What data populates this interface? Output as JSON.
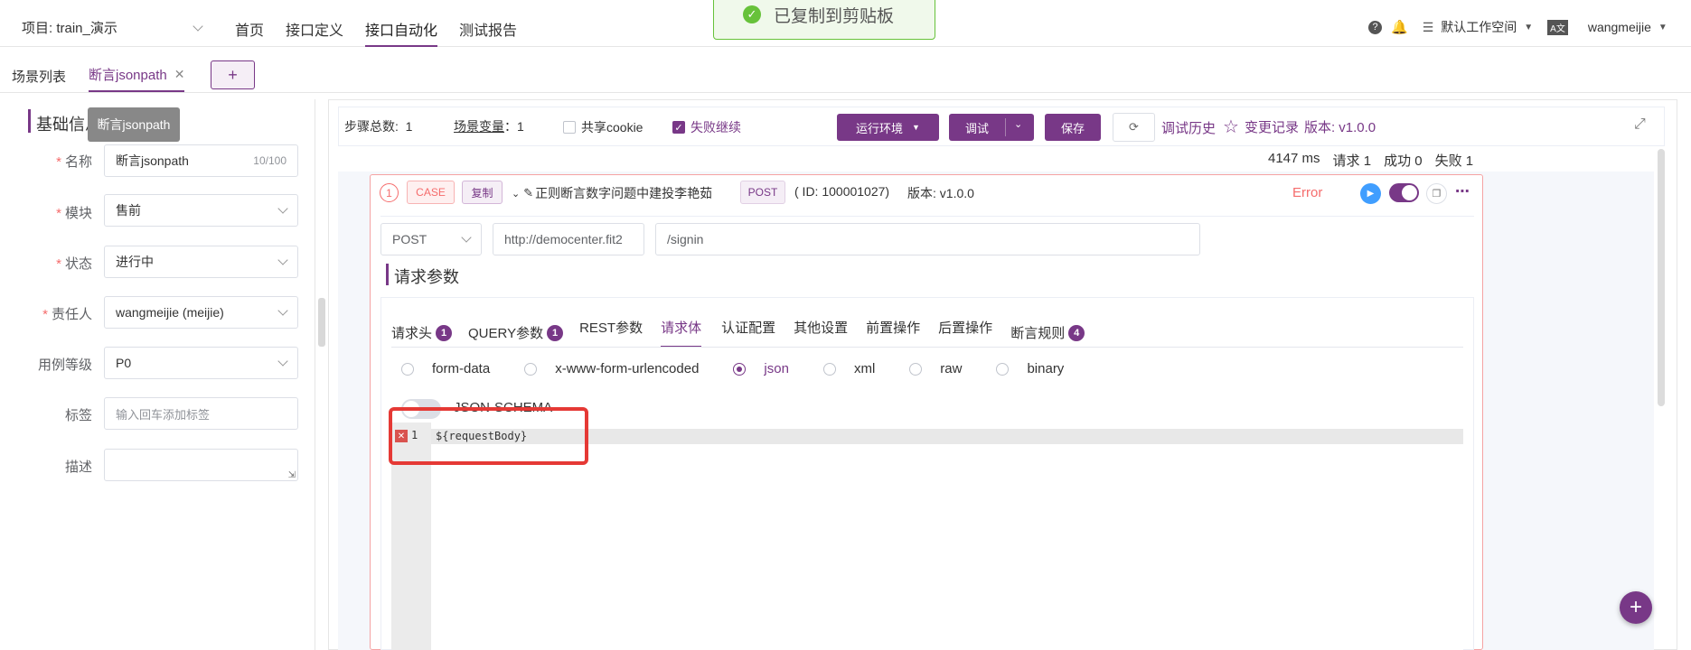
{
  "topbar": {
    "project_label": "项目: train_演示",
    "nav": [
      "首页",
      "接口定义",
      "接口自动化",
      "测试报告"
    ],
    "workspace": "默认工作空间",
    "user": "wangmeijie"
  },
  "toast": {
    "text": "已复制到剪贴板"
  },
  "tabs": {
    "list": "场景列表",
    "active": "断言jsonpath",
    "add": "+"
  },
  "left": {
    "section_title": "基础信息",
    "tooltip": "断言jsonpath",
    "fields": {
      "name_label": "名称",
      "name_value": "断言jsonpath",
      "name_count": "10/100",
      "module_label": "模块",
      "module_value": "售前",
      "status_label": "状态",
      "status_value": "进行中",
      "owner_label": "责任人",
      "owner_value": "wangmeijie (meijie)",
      "level_label": "用例等级",
      "level_value": "P0",
      "tag_label": "标签",
      "tag_placeholder": "输入回车添加标签",
      "desc_label": "描述"
    }
  },
  "toolbar": {
    "steps_label": "步骤总数:",
    "steps_value": "1",
    "vars_label": "场景变量",
    "vars_value": "1",
    "cookie": "共享cookie",
    "fail_continue": "失败继续",
    "env": "运行环境",
    "debug": "调试",
    "save": "保存",
    "history": "调试历史",
    "changelog": "变更记录",
    "version": "版本: v1.0.0"
  },
  "stats": {
    "time": "4147 ms",
    "requests": "请求 1",
    "success": "成功 0",
    "fail": "失败 1"
  },
  "case": {
    "index": "1",
    "tag_case": "CASE",
    "tag_copy": "复制",
    "name": "正则断言数字问题中建投李艳茹",
    "method_tag": "POST",
    "id": "( ID: 100001027)",
    "version": "版本: v1.0.0",
    "status": "Error",
    "method": "POST",
    "url": "http://democenter.fit2",
    "path": "/signin",
    "params_title": "请求参数",
    "ptabs": [
      {
        "label": "请求头",
        "badge": "1"
      },
      {
        "label": "QUERY参数",
        "badge": "1"
      },
      {
        "label": "REST参数",
        "badge": ""
      },
      {
        "label": "请求体",
        "badge": ""
      },
      {
        "label": "认证配置",
        "badge": ""
      },
      {
        "label": "其他设置",
        "badge": ""
      },
      {
        "label": "前置操作",
        "badge": ""
      },
      {
        "label": "后置操作",
        "badge": ""
      },
      {
        "label": "断言规则",
        "badge": "4"
      }
    ],
    "body_types": [
      "form-data",
      "x-www-form-urlencoded",
      "json",
      "xml",
      "raw",
      "binary"
    ],
    "json_schema": "JSON-SCHEMA",
    "code_line": "1",
    "code": "${requestBody}"
  },
  "colors": {
    "accent": "#783887",
    "error": "#f56c6c",
    "success": "#67c23a"
  }
}
